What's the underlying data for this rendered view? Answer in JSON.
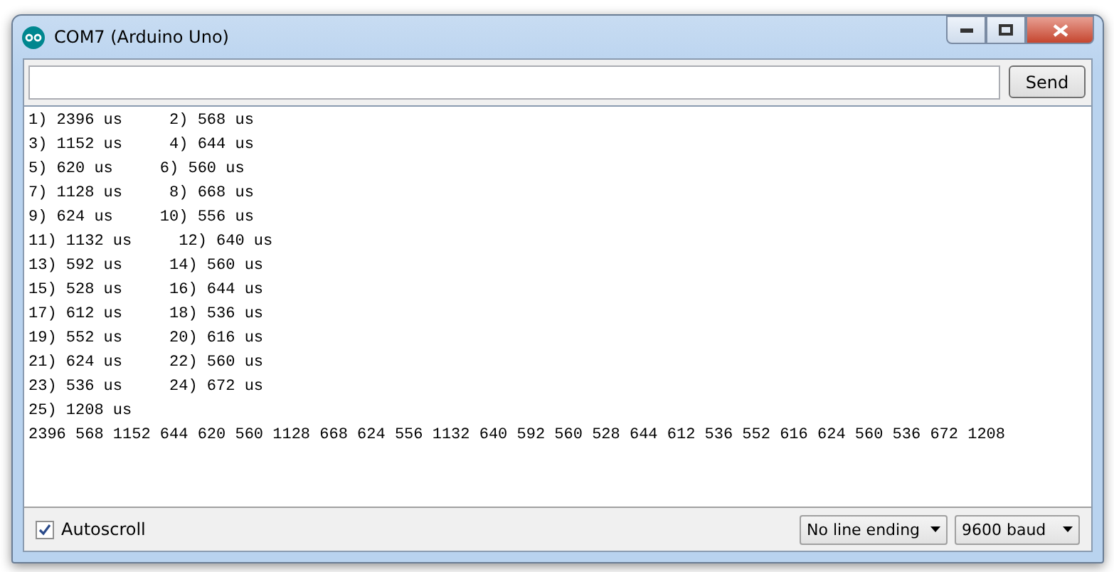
{
  "window": {
    "title": "COM7 (Arduino Uno)"
  },
  "send_button": "Send",
  "output_lines": [
    "1) 2396 us     2) 568 us",
    "3) 1152 us     4) 644 us",
    "5) 620 us     6) 560 us",
    "7) 1128 us     8) 668 us",
    "9) 624 us     10) 556 us",
    "11) 1132 us     12) 640 us",
    "13) 592 us     14) 560 us",
    "15) 528 us     16) 644 us",
    "17) 612 us     18) 536 us",
    "19) 552 us     20) 616 us",
    "21) 624 us     22) 560 us",
    "23) 536 us     24) 672 us",
    "25) 1208 us",
    "2396 568 1152 644 620 560 1128 668 624 556 1132 640 592 560 528 644 612 536 552 616 624 560 536 672 1208"
  ],
  "autoscroll": {
    "label": "Autoscroll",
    "checked": true
  },
  "dropdowns": [
    {
      "value": "No line ending"
    },
    {
      "value": "9600 baud"
    }
  ]
}
